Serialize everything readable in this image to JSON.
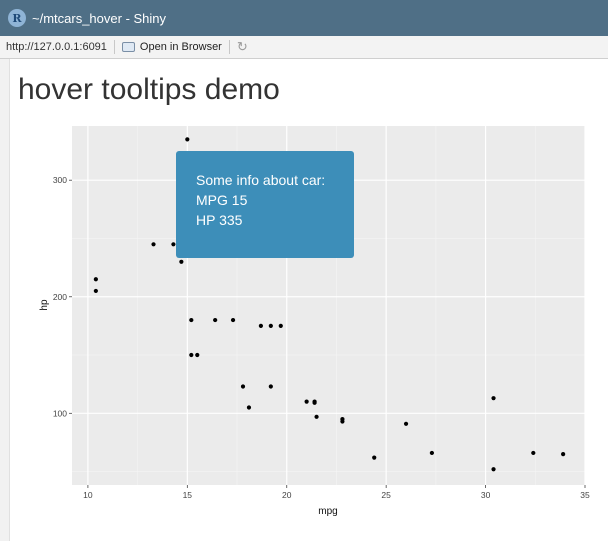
{
  "window": {
    "app_icon": "R",
    "title": "~/mtcars_hover - Shiny"
  },
  "toolbar": {
    "url": "http://127.0.0.1:6091",
    "open_in_browser": "Open in Browser",
    "refresh_icon": "refresh-icon"
  },
  "page": {
    "title": "hover tooltips demo"
  },
  "tooltip": {
    "heading": "Some info about car:",
    "mpg_line": "MPG 15",
    "hp_line": "HP 335"
  },
  "colors": {
    "titlebar": "#4f6f86",
    "panel_bg": "#ebebeb",
    "tooltip_bg": "#3d8eb9",
    "point": "#000000"
  },
  "chart_data": {
    "type": "scatter",
    "xlabel": "mpg",
    "ylabel": "hp",
    "xlim": [
      9.2,
      35.0
    ],
    "ylim": [
      38.5,
      346.5
    ],
    "xticks": [
      10,
      15,
      20,
      25,
      30,
      35
    ],
    "yticks": [
      100,
      200,
      300
    ],
    "grid": true,
    "points": [
      {
        "x": 10.4,
        "y": 205
      },
      {
        "x": 10.4,
        "y": 215
      },
      {
        "x": 13.3,
        "y": 245
      },
      {
        "x": 14.3,
        "y": 245
      },
      {
        "x": 14.7,
        "y": 230
      },
      {
        "x": 15.0,
        "y": 335
      },
      {
        "x": 15.2,
        "y": 180
      },
      {
        "x": 15.2,
        "y": 150
      },
      {
        "x": 15.5,
        "y": 150
      },
      {
        "x": 16.4,
        "y": 180
      },
      {
        "x": 17.3,
        "y": 180
      },
      {
        "x": 17.8,
        "y": 123
      },
      {
        "x": 18.1,
        "y": 105
      },
      {
        "x": 18.7,
        "y": 175
      },
      {
        "x": 19.2,
        "y": 175
      },
      {
        "x": 19.2,
        "y": 123
      },
      {
        "x": 19.7,
        "y": 175
      },
      {
        "x": 21.0,
        "y": 110
      },
      {
        "x": 21.4,
        "y": 110
      },
      {
        "x": 21.4,
        "y": 109
      },
      {
        "x": 21.5,
        "y": 97
      },
      {
        "x": 22.8,
        "y": 93
      },
      {
        "x": 22.8,
        "y": 95
      },
      {
        "x": 24.4,
        "y": 62
      },
      {
        "x": 26.0,
        "y": 91
      },
      {
        "x": 27.3,
        "y": 66
      },
      {
        "x": 30.4,
        "y": 113
      },
      {
        "x": 30.4,
        "y": 52
      },
      {
        "x": 32.4,
        "y": 66
      },
      {
        "x": 33.9,
        "y": 65
      }
    ]
  }
}
